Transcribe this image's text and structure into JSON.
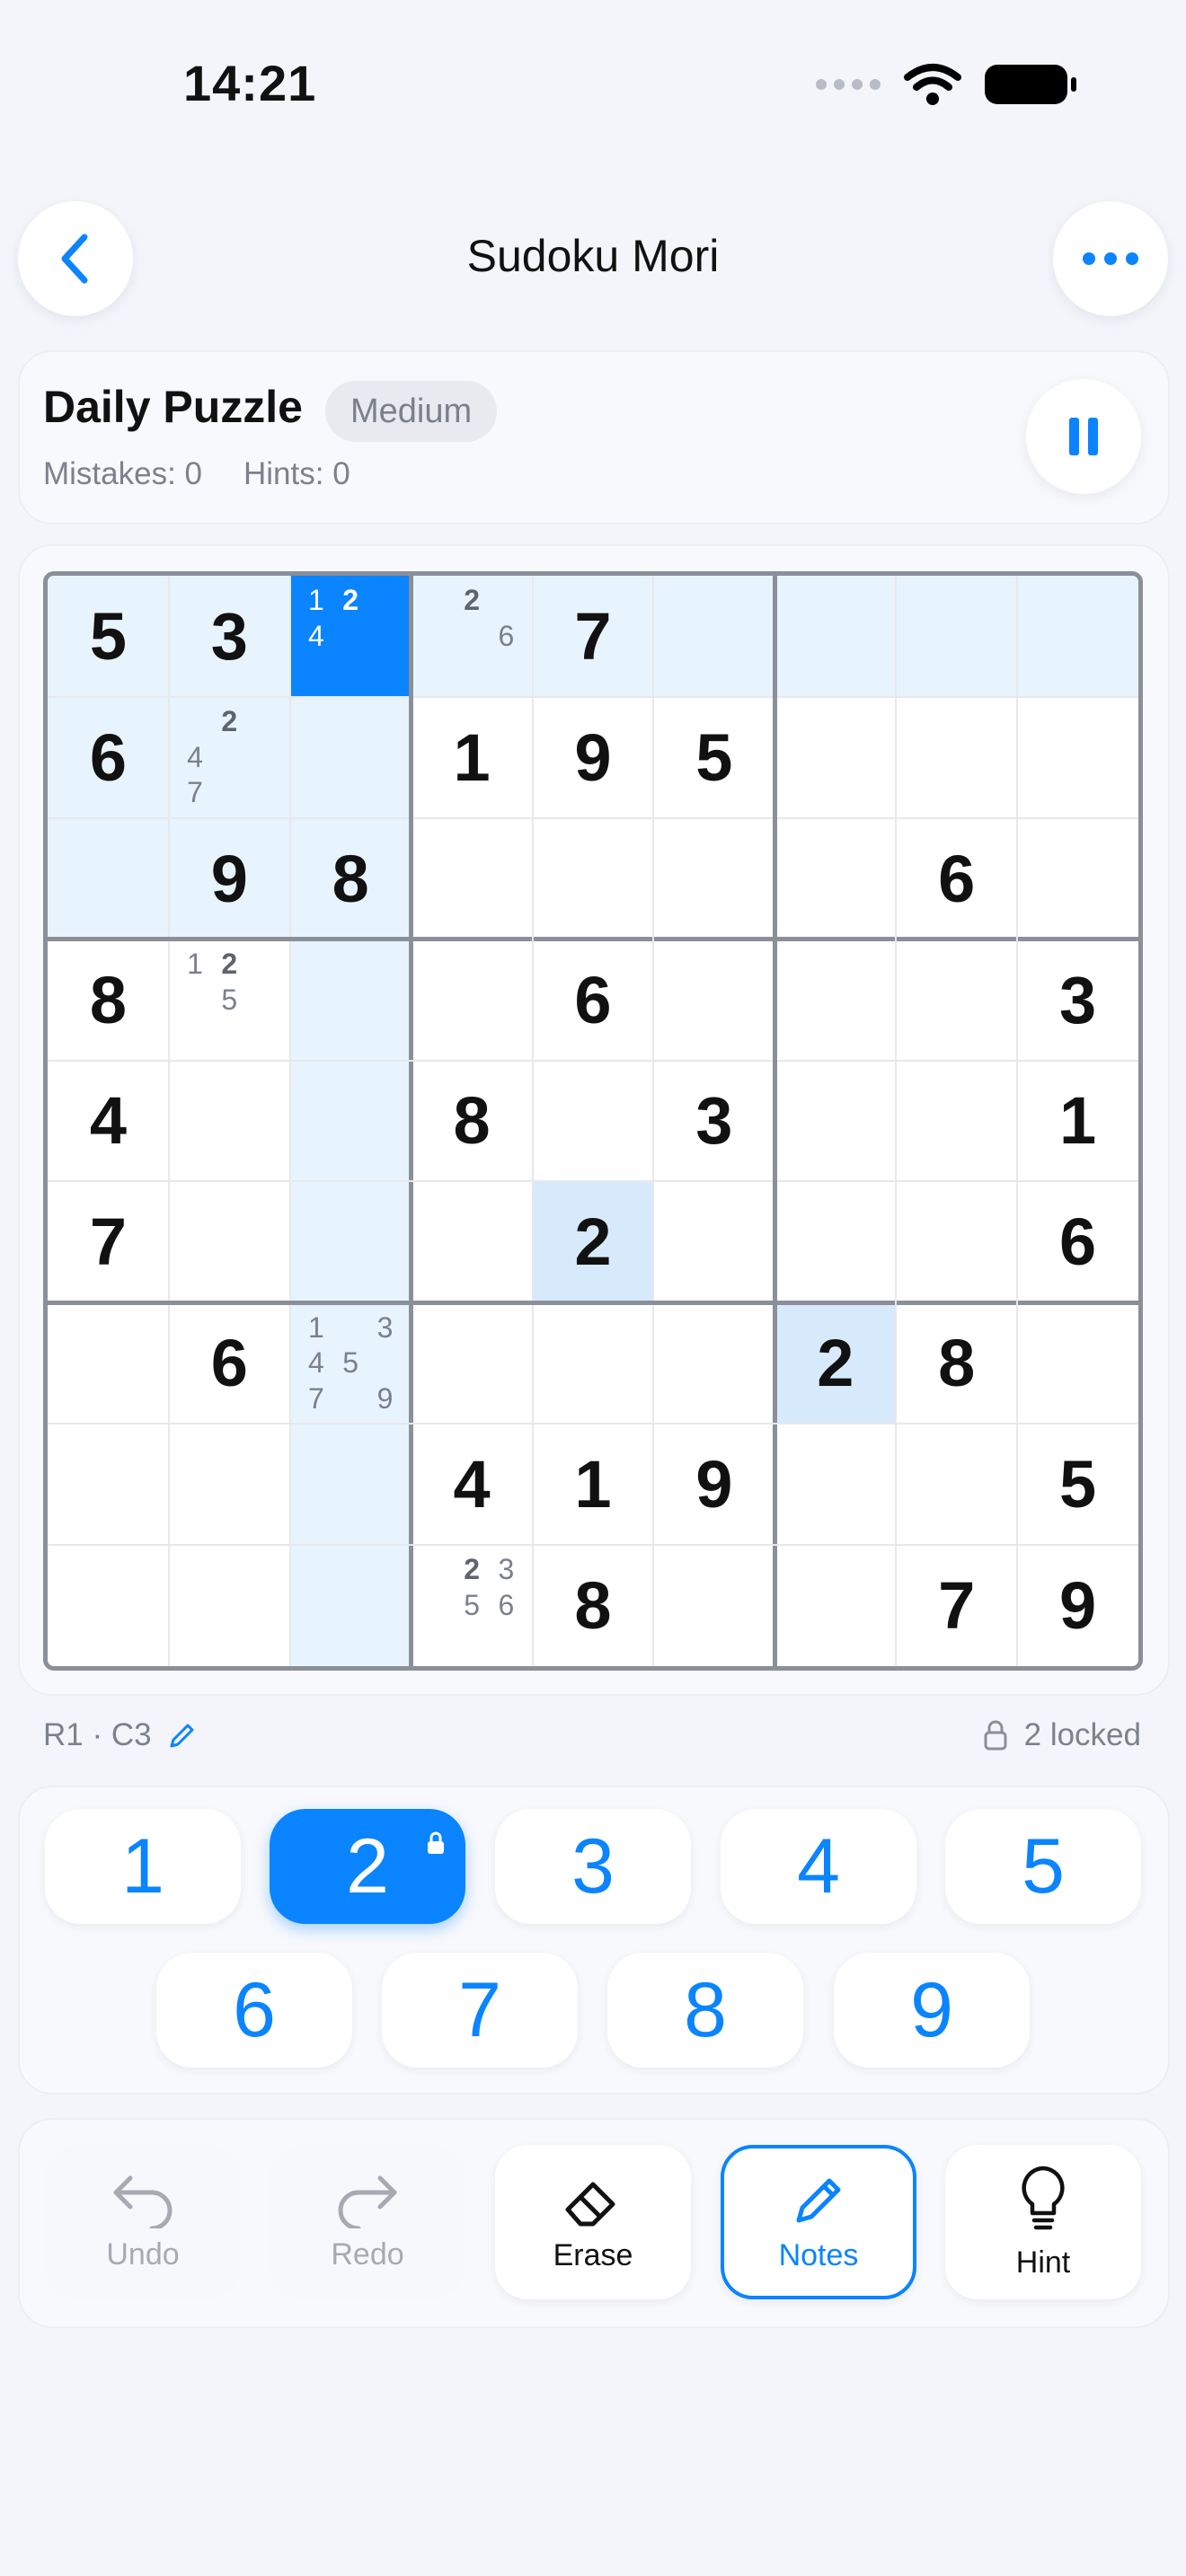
{
  "status": {
    "time": "14:21"
  },
  "nav": {
    "title": "Sudoku Mori"
  },
  "header": {
    "title": "Daily Puzzle",
    "difficulty": "Medium",
    "mistakes": "Mistakes: 0",
    "hints": "Hints: 0"
  },
  "board": {
    "values": [
      [
        5,
        3,
        0,
        0,
        7,
        0,
        0,
        0,
        0
      ],
      [
        6,
        0,
        0,
        1,
        9,
        5,
        0,
        0,
        0
      ],
      [
        0,
        9,
        8,
        0,
        0,
        0,
        0,
        6,
        0
      ],
      [
        8,
        0,
        0,
        0,
        6,
        0,
        0,
        0,
        3
      ],
      [
        4,
        0,
        0,
        8,
        0,
        3,
        0,
        0,
        1
      ],
      [
        7,
        0,
        0,
        0,
        2,
        0,
        0,
        0,
        6
      ],
      [
        0,
        6,
        0,
        0,
        0,
        0,
        2,
        8,
        0
      ],
      [
        0,
        0,
        0,
        4,
        1,
        9,
        0,
        0,
        5
      ],
      [
        0,
        0,
        0,
        0,
        8,
        0,
        0,
        7,
        9
      ]
    ],
    "notes": [
      {
        "r": 0,
        "c": 2,
        "n": [
          1,
          2,
          4
        ],
        "bold": [
          2
        ]
      },
      {
        "r": 0,
        "c": 3,
        "n": [
          2,
          6
        ],
        "bold": [
          2
        ]
      },
      {
        "r": 1,
        "c": 1,
        "n": [
          2,
          4,
          7
        ],
        "bold": [
          2
        ]
      },
      {
        "r": 3,
        "c": 1,
        "n": [
          1,
          2,
          5
        ],
        "bold": [
          2
        ]
      },
      {
        "r": 6,
        "c": 2,
        "n": [
          1,
          3,
          4,
          5,
          7,
          9
        ],
        "bold": []
      },
      {
        "r": 8,
        "c": 3,
        "n": [
          2,
          3,
          5,
          6
        ],
        "bold": [
          2
        ]
      }
    ],
    "selected": {
      "r": 0,
      "c": 2
    },
    "selected_number": 2
  },
  "info": {
    "position": "R1 · C3",
    "locked": "2 locked"
  },
  "numpad": [
    "1",
    "2",
    "3",
    "4",
    "5",
    "6",
    "7",
    "8",
    "9"
  ],
  "tools": {
    "undo": "Undo",
    "redo": "Redo",
    "erase": "Erase",
    "notes": "Notes",
    "hint": "Hint"
  },
  "colors": {
    "accent": "#0a84ff",
    "highlight": "#e8f4fd",
    "same_number": "#d7eafb"
  },
  "icons": [
    "chevron-left-icon",
    "more-icon",
    "pause-icon",
    "pencil-icon",
    "lock-icon",
    "undo-icon",
    "redo-icon",
    "eraser-icon",
    "lightbulb-icon"
  ]
}
